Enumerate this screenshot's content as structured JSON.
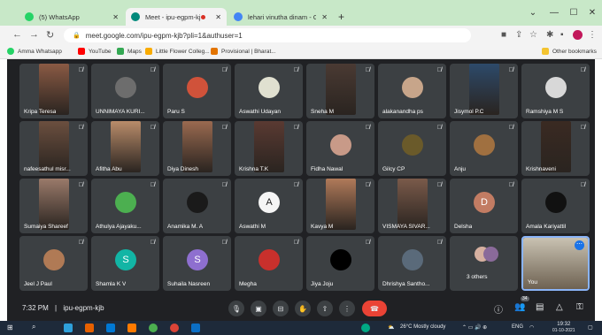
{
  "browser": {
    "tabs": [
      {
        "label": "(5) WhatsApp",
        "icon": "whatsapp-icon",
        "color": "#25d366"
      },
      {
        "label": "Meet - ipu-egpm-kjb",
        "icon": "meet-icon",
        "color": "#00897b",
        "active": true
      },
      {
        "label": "lehari vinutha dinam - Google Se",
        "icon": "google-icon",
        "color": "#4285f4"
      }
    ],
    "url": "meet.google.com/ipu-egpm-kjb?pli=1&authuser=1",
    "bookmarks": [
      {
        "label": "Amma Whatsapp",
        "color": "#25d366"
      },
      {
        "label": "YouTube",
        "color": "#ff0000"
      },
      {
        "label": "Maps",
        "color": "#34a853"
      },
      {
        "label": "Little Flower Colleg...",
        "color": "#f9ab00"
      },
      {
        "label": "Provisional | Bharat...",
        "color": "#e37400"
      }
    ],
    "other_bookmarks": "Other bookmarks"
  },
  "participants": [
    {
      "name": "Kripa Teresa",
      "type": "photo",
      "color": "#8a5a44"
    },
    {
      "name": "UNNIMAYA KURI...",
      "type": "avatar",
      "color": "#6d6d6d"
    },
    {
      "name": "Paru S",
      "type": "avatar",
      "color": "#d0523a"
    },
    {
      "name": "Aswathi Udayan",
      "type": "avatar",
      "color": "#e0e0d0"
    },
    {
      "name": "Sneha M",
      "type": "photo",
      "color": "#4a3a33"
    },
    {
      "name": "alakanandha ps",
      "type": "avatar",
      "color": "#c7a58a"
    },
    {
      "name": "Jisymol P.C",
      "type": "photo",
      "color": "#2d4a6a"
    },
    {
      "name": "Ramshiya M S",
      "type": "avatar",
      "color": "#d8d8d8"
    },
    {
      "name": "nafeesathul misr...",
      "type": "photo",
      "color": "#6b4f3f"
    },
    {
      "name": "Afitha Abu",
      "type": "photo",
      "color": "#b98c6a"
    },
    {
      "name": "Diya Dinesh",
      "type": "photo",
      "color": "#9a6a50"
    },
    {
      "name": "Krishna T.K",
      "type": "photo",
      "color": "#5a3a32"
    },
    {
      "name": "Fidha Nawal",
      "type": "avatar",
      "color": "#c89a88"
    },
    {
      "name": "Gilcy CP",
      "type": "avatar",
      "color": "#6a5a2a"
    },
    {
      "name": "Anju",
      "type": "avatar",
      "color": "#a07040"
    },
    {
      "name": "Krishnaveni",
      "type": "photo",
      "color": "#3a2a22"
    },
    {
      "name": "Sumaiya Shareef",
      "type": "photo",
      "color": "#9a7a6a"
    },
    {
      "name": "Athulya Ajayaku...",
      "type": "avatar",
      "color": "#4caf50"
    },
    {
      "name": "Anamika M. A",
      "type": "avatar",
      "color": "#1a1a1a"
    },
    {
      "name": "Aswathi M",
      "type": "avatar",
      "color": "#f5f5f5",
      "letter": "A"
    },
    {
      "name": "Kavya M",
      "type": "photo",
      "color": "#b07a5a"
    },
    {
      "name": "VISMAYA SIVAR...",
      "type": "photo",
      "color": "#7a5a4a"
    },
    {
      "name": "Delsha",
      "type": "avatar",
      "color": "#c27c63",
      "letter": "D"
    },
    {
      "name": "Amala Kariyattil",
      "type": "avatar",
      "color": "#111111"
    },
    {
      "name": "Jeel J Paul",
      "type": "avatar",
      "color": "#b07a55"
    },
    {
      "name": "Shamla K V",
      "type": "avatar",
      "color": "#12b5a5",
      "letter": "S"
    },
    {
      "name": "Suhaila Nasreen",
      "type": "avatar",
      "color": "#8e6fcf",
      "letter": "S"
    },
    {
      "name": "Megha",
      "type": "avatar",
      "color": "#c9302c"
    },
    {
      "name": "Jiya Joju",
      "type": "avatar",
      "color": "#000000"
    },
    {
      "name": "Dhrishya Santho...",
      "type": "avatar",
      "color": "#5a6a7a"
    },
    {
      "name": "3 others",
      "type": "others",
      "color": "#3c4043"
    },
    {
      "name": "You",
      "type": "self",
      "color": "#b0a090"
    }
  ],
  "meeting": {
    "time": "7:32 PM",
    "separator": "|",
    "code": "ipu-egpm-kjb",
    "participant_count": "34"
  },
  "taskbar": {
    "weather": "26°C  Mostly cloudy",
    "lang": "ENG",
    "clock_time": "19:32",
    "clock_date": "01-10-2021"
  }
}
